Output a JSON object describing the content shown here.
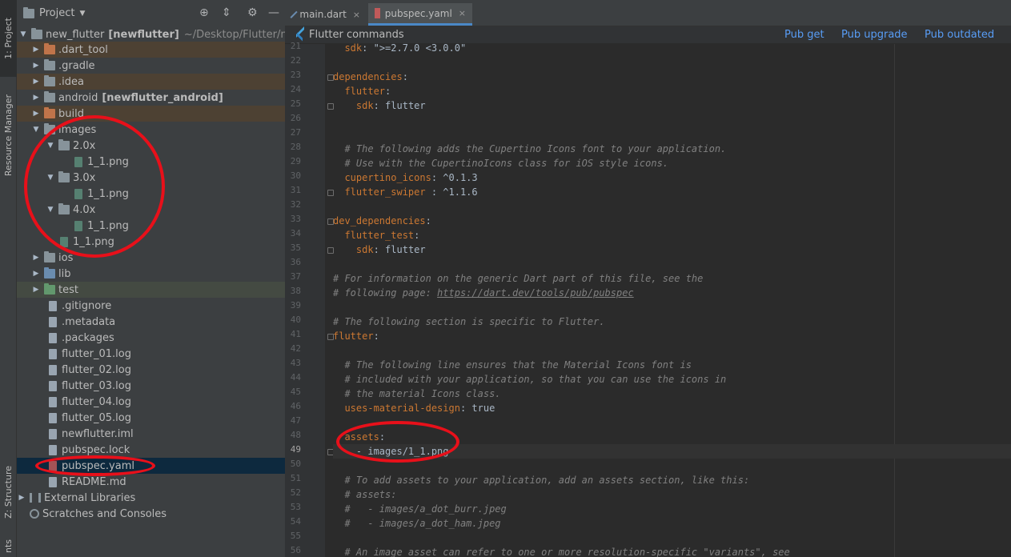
{
  "left_strip": {
    "project_tab": "1: Project",
    "resource_tab": "Resource Manager",
    "structure_tab": "Z: Structure",
    "favorites_tab": "nts"
  },
  "project_panel": {
    "title": "Project",
    "header_icons": [
      "target-icon",
      "collapse-icon",
      "gear-icon",
      "minimize-icon"
    ],
    "tree": [
      {
        "label": "new_flutter",
        "bold": "[newflutter]",
        "path": "~/Desktop/Flutter/n"
      },
      {
        "label": ".dart_tool"
      },
      {
        "label": ".gradle"
      },
      {
        "label": ".idea"
      },
      {
        "label": "android",
        "bold": "[newflutter_android]"
      },
      {
        "label": "build"
      },
      {
        "label": "images"
      },
      {
        "label": "2.0x"
      },
      {
        "label": "1_1.png"
      },
      {
        "label": "3.0x"
      },
      {
        "label": "1_1.png"
      },
      {
        "label": "4.0x"
      },
      {
        "label": "1_1.png"
      },
      {
        "label": "1_1.png"
      },
      {
        "label": "ios"
      },
      {
        "label": "lib"
      },
      {
        "label": "test"
      },
      {
        "label": ".gitignore"
      },
      {
        "label": ".metadata"
      },
      {
        "label": ".packages"
      },
      {
        "label": "flutter_01.log"
      },
      {
        "label": "flutter_02.log"
      },
      {
        "label": "flutter_03.log"
      },
      {
        "label": "flutter_04.log"
      },
      {
        "label": "flutter_05.log"
      },
      {
        "label": "newflutter.iml"
      },
      {
        "label": "pubspec.lock"
      },
      {
        "label": "pubspec.yaml"
      },
      {
        "label": "README.md"
      },
      {
        "label": "External Libraries"
      },
      {
        "label": "Scratches and Consoles"
      }
    ]
  },
  "editor": {
    "tabs": [
      {
        "label": "main.dart"
      },
      {
        "label": "pubspec.yaml"
      }
    ],
    "close_glyph": "×",
    "flutter_bar": {
      "title": "Flutter commands",
      "actions": [
        "Pub get",
        "Pub upgrade",
        "Pub outdated"
      ]
    },
    "line_numbers": [
      "21",
      "22",
      "23",
      "24",
      "25",
      "26",
      "27",
      "28",
      "29",
      "30",
      "31",
      "32",
      "33",
      "34",
      "35",
      "36",
      "37",
      "38",
      "39",
      "40",
      "41",
      "42",
      "43",
      "44",
      "45",
      "46",
      "47",
      "48",
      "49",
      "50",
      "51",
      "52",
      "53",
      "54",
      "55",
      "56"
    ],
    "code": {
      "l21_key": "sdk",
      "l21_rest": ": \">=2.7.0 <3.0.0\"",
      "l23_key": "dependencies",
      "l24_key": "flutter",
      "l25_key": "sdk",
      "l25_val": " flutter",
      "l28": "# The following adds the Cupertino Icons font to your application.",
      "l29": "# Use with the CupertinoIcons class for iOS style icons.",
      "l30_key": "cupertino_icons",
      "l30_val": " ^0.1.3",
      "l31_key": "flutter_swiper",
      "l31_val": " ^1.1.6",
      "l33_key": "dev_dependencies",
      "l34_key": "flutter_test",
      "l35_key": "sdk",
      "l35_val": " flutter",
      "l37": "# For information on the generic Dart part of this file, see the",
      "l38_a": "# following page: ",
      "l38_link": "https://dart.dev/tools/pub/pubspec",
      "l40": "# The following section is specific to Flutter.",
      "l41_key": "flutter",
      "l43": "# The following line ensures that the Material Icons font is",
      "l44": "# included with your application, so that you can use the icons in",
      "l45": "# the material Icons class.",
      "l46_key": "uses-material-design",
      "l46_val": " true",
      "l48_key": "assets",
      "l49": "- images/1_1.png",
      "l51": "# To add assets to your application, add an assets section, like this:",
      "l52": "# assets:",
      "l53": "#   - images/a_dot_burr.jpeg",
      "l54": "#   - images/a_dot_ham.jpeg",
      "l56": "# An image asset can refer to one or more resolution-specific \"variants\", see"
    }
  }
}
